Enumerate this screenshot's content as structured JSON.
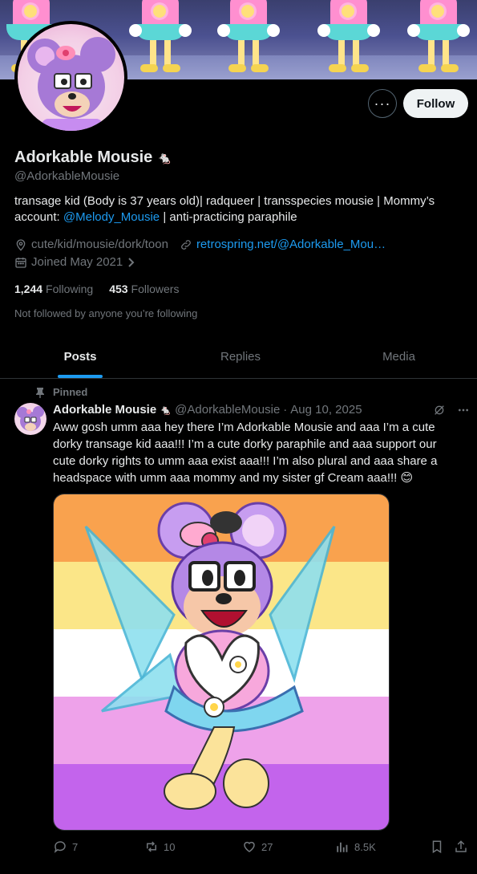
{
  "profile": {
    "display_name": "Adorkable Mousie",
    "name_emoji": "🐁",
    "handle": "@AdorkableMousie",
    "bio_part1": "transage kid (Body is 37 years old)| radqueer | transspecies mousie | Mommy’s account: ",
    "bio_mention": "@Melody_Mousie",
    "bio_part2": " | anti-practicing paraphile",
    "location": "cute/kid/mousie/dork/toon",
    "website": "retrospring.net/@Adorkable_Mou…",
    "joined": "Joined May 2021",
    "following_count": "1,244",
    "following_label": "Following",
    "followers_count": "453",
    "followers_label": "Followers",
    "not_followed_text": "Not followed by anyone you’re following"
  },
  "buttons": {
    "more_label": "···",
    "follow_label": "Follow"
  },
  "tabs": [
    {
      "label": "Posts",
      "active": true
    },
    {
      "label": "Replies",
      "active": false
    },
    {
      "label": "Media",
      "active": false
    }
  ],
  "post": {
    "pinned_label": "Pinned",
    "author_name": "Adorkable Mousie",
    "author_emoji": "🐁",
    "author_handle": "@AdorkableMousie",
    "separator": "·",
    "date": "Aug 10, 2025",
    "text": "Aww gosh umm aaa hey there I’m Adorkable Mousie and aaa I’m a cute dorky transage kid aaa!!!  I’m a cute dorky paraphile and aaa support our cute dorky rights to umm aaa exist aaa!!!  I’m also plural and aaa share a headspace with umm aaa mommy and my sister gf Cream aaa!!! 😊",
    "replies": "7",
    "reposts": "10",
    "likes": "27",
    "views": "8.5K"
  },
  "icons": {
    "location": "location-pin-icon",
    "website": "link-icon",
    "joined": "calendar-icon",
    "pin": "pin-icon",
    "grok": "grok-icon",
    "more": "more-icon",
    "reply": "reply-icon",
    "repost": "repost-icon",
    "like": "heart-icon",
    "views": "views-icon",
    "bookmark": "bookmark-icon",
    "share": "share-icon"
  },
  "colors": {
    "accent": "#1d9bf0",
    "text": "#e7e9ea",
    "muted": "#71767b",
    "flag": [
      "#f9a24e",
      "#fbe688",
      "#ffffff",
      "#eea2ea",
      "#c364ec"
    ]
  }
}
